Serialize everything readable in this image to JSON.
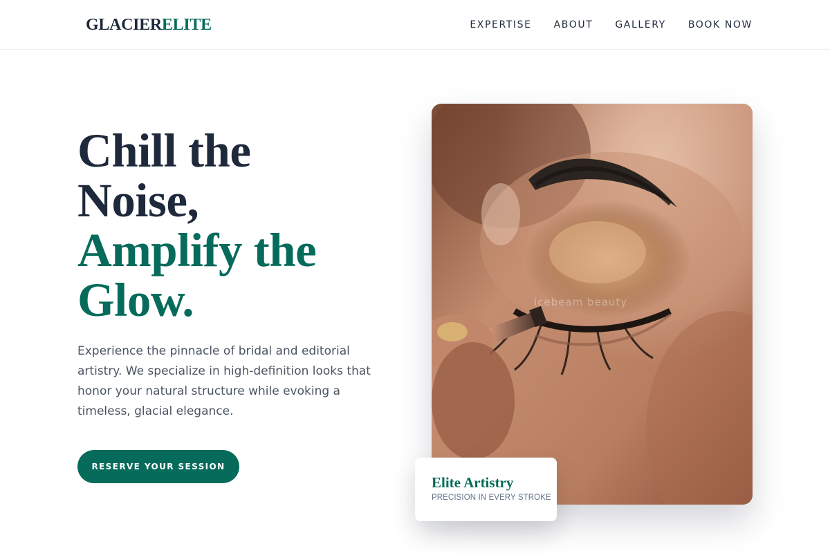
{
  "header": {
    "logo_part1": "GLACIER",
    "logo_part2": "ELITE",
    "nav": [
      {
        "label": "EXPERTISE"
      },
      {
        "label": "ABOUT"
      },
      {
        "label": "GALLERY"
      },
      {
        "label": "BOOK NOW"
      }
    ]
  },
  "hero": {
    "headline_line1": "Chill the",
    "headline_line2": "Noise,",
    "headline_line3": "Amplify the",
    "headline_line4": "Glow.",
    "description": "Experience the pinnacle of bridal and editorial artistry. We specialize in high-definition looks that honor your natural structure while evoking a timeless, glacial elegance.",
    "cta_label": "RESERVE YOUR SESSION"
  },
  "image": {
    "watermark": "icebeam beauty"
  },
  "card": {
    "title": "Elite Artistry",
    "subtitle": "PRECISION IN EVERY STROKE"
  },
  "colors": {
    "accent": "#066b5b",
    "text_dark": "#1e293b",
    "text_muted": "#4b5563"
  }
}
